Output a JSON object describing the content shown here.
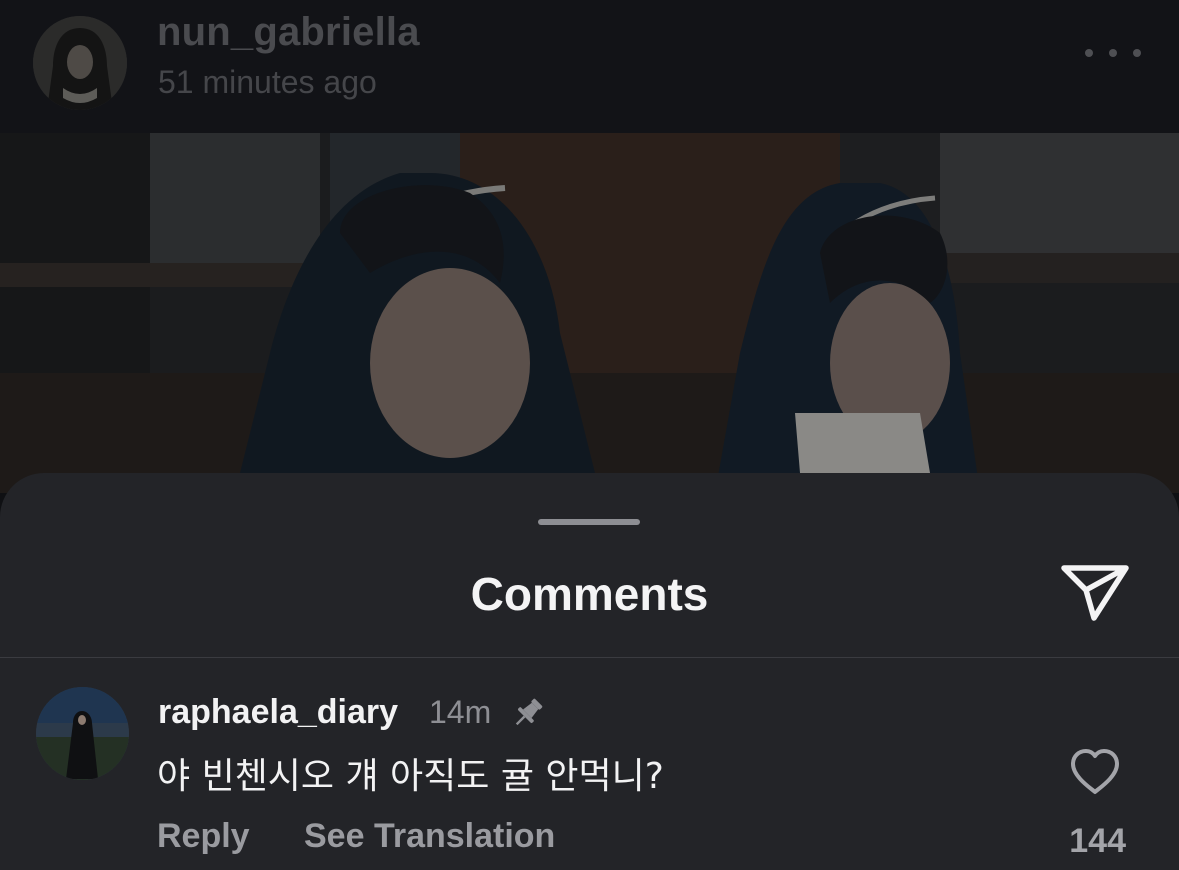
{
  "post": {
    "username": "nun_gabriella",
    "time": "51 minutes ago",
    "more_icon": "more-horizontal-icon"
  },
  "sheet": {
    "title": "Comments",
    "share_icon": "send-icon"
  },
  "comment": {
    "username": "raphaela_diary",
    "time": "14m",
    "pinned_icon": "pin-icon",
    "text": "야 빈첸시오 걔 아직도 귤 안먹니?",
    "reply_label": "Reply",
    "translate_label": "See Translation",
    "like_icon": "heart-icon",
    "like_count": "144"
  },
  "colors": {
    "sheet_background": "#232428",
    "primary_text": "#f2f2f3",
    "secondary_text": "#9a9ba0"
  }
}
